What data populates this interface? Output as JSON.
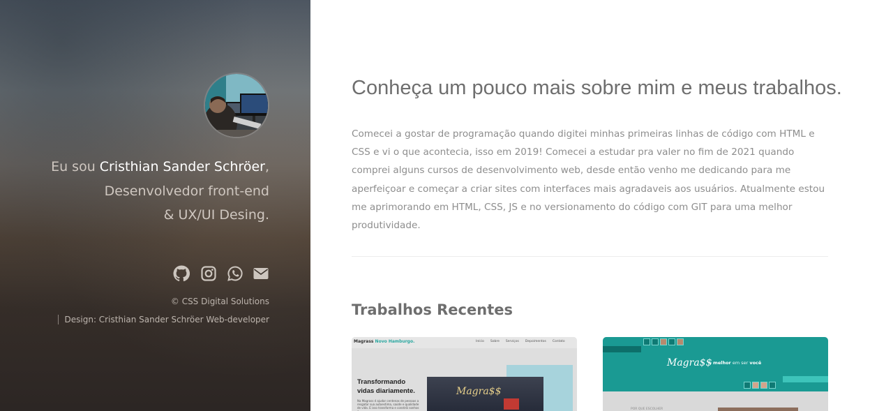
{
  "sidebar": {
    "intro_prefix": "Eu sou ",
    "name": "Cristhian Sander Schröer",
    "intro_comma": ",",
    "role_line1": "Desenvolvedor front-end",
    "role_line2": "& UX/UI Desing.",
    "socials": [
      {
        "icon": "github-icon"
      },
      {
        "icon": "instagram-icon"
      },
      {
        "icon": "whatsapp-icon"
      },
      {
        "icon": "email-icon"
      }
    ],
    "copyright": "© CSS Digital Solutions",
    "credits": "Design: Cristhian Sander Schröer Web-developer"
  },
  "main": {
    "headline": "Conheça um pouco mais sobre mim e meus trabalhos.",
    "about": "Comecei a gostar de programação quando digitei minhas primeiras linhas de código com HTML e CSS e vi o que acontecia, isso em 2019! Comecei a estudar pra valer no fim de 2021 quando comprei alguns cursos de desenvolvimento web, desde então venho me dedicando para me aperfeiçoar e começar a criar sites com interfaces mais agradaveis aos usuários. Atualmente estou me aprimorando em HTML, CSS, JS e no versionamento do código com GIT para uma melhor produtividade.",
    "section_title": "Trabalhos Recentes",
    "projects": [
      {
        "brand": "Magrass",
        "brand_accent": " Novo Hamburgo.",
        "menu": [
          "Início",
          "Sobre",
          "Serviços",
          "Depoimentos",
          "Contato"
        ],
        "heading_line1": "Transformando",
        "heading_line2": "vidas diariamente.",
        "text": "Na Magrass é ajudar centenas de pessoas a resgatar sua autoestima, saúde e qualidade de vida. E isso transforma e constrói sonhos e",
        "logo": "Magra$$"
      },
      {
        "logo": "Magra$$",
        "tagline_prefix": "o ",
        "tagline_bold": "melhor",
        "tagline_mid": " em ser ",
        "tagline_end": "você",
        "small_text": "POR QUE ESCOLHER"
      }
    ]
  },
  "colors": {
    "sidebar_text": "#cfc7c0",
    "name_white": "#ffffff",
    "headline": "#6e6e6e",
    "body_text": "#8d8d8d",
    "teal": "#1a9a93"
  }
}
